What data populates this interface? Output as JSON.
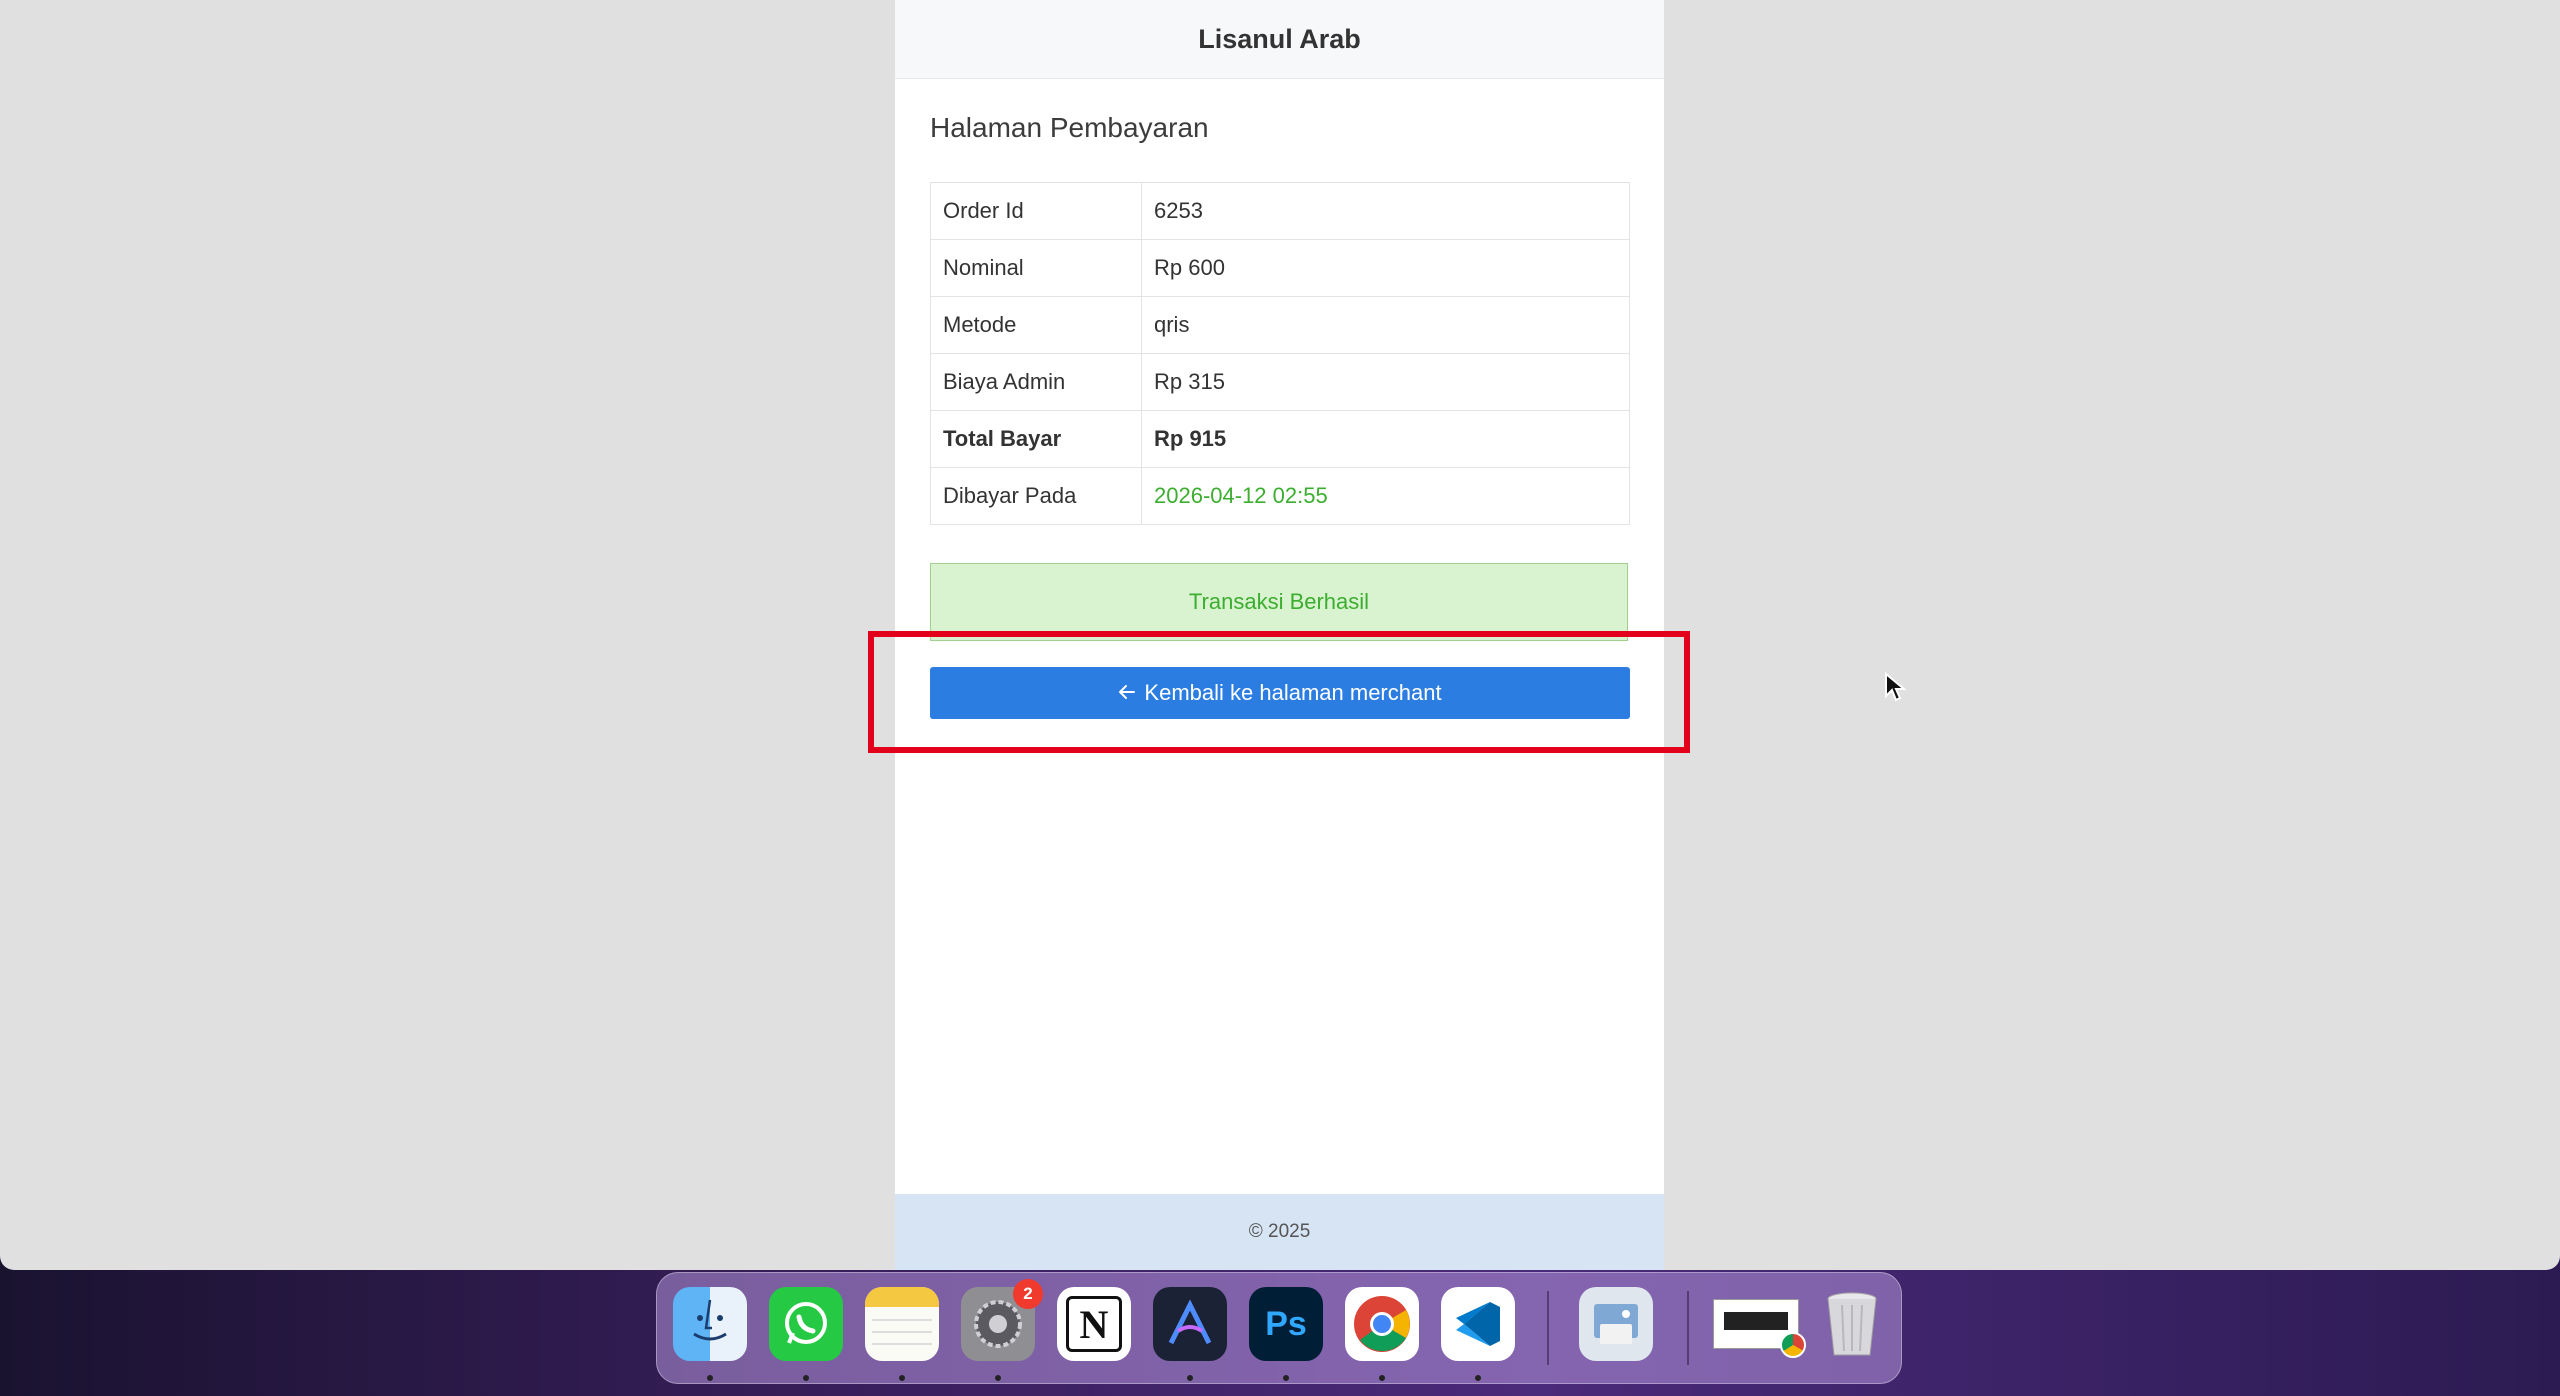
{
  "page": {
    "site_title": "Lisanul Arab",
    "heading": "Halaman Pembayaran",
    "rows": [
      {
        "label": "Order Id",
        "value": "6253"
      },
      {
        "label": "Nominal",
        "value": "Rp 600"
      },
      {
        "label": "Metode",
        "value": "qris"
      },
      {
        "label": "Biaya Admin",
        "value": "Rp 315"
      },
      {
        "label": "Total Bayar",
        "value": "Rp 915"
      },
      {
        "label": "Dibayar Pada",
        "value": "2026-04-12 02:55"
      }
    ],
    "status_message": "Transaksi Berhasil",
    "back_button_label": "Kembali ke halaman merchant",
    "back_button_icon": "arrow-left-icon",
    "footer": "© 2025"
  },
  "colors": {
    "primary_button": "#2b7de1",
    "success_text": "#3cae2f",
    "success_bg": "#d9f2d0",
    "highlight": "#e3001b"
  },
  "dock": {
    "apps": [
      {
        "name": "Finder",
        "icon": "finder-icon",
        "running": true
      },
      {
        "name": "WhatsApp",
        "icon": "whatsapp-icon",
        "running": true
      },
      {
        "name": "Notes",
        "icon": "notes-icon",
        "running": true
      },
      {
        "name": "System Settings",
        "icon": "settings-icon",
        "running": true,
        "badge": "2"
      },
      {
        "name": "Notion",
        "icon": "notion-icon",
        "running": false
      },
      {
        "name": "Affinity Designer",
        "icon": "affinity-icon",
        "running": true
      },
      {
        "name": "Photoshop",
        "icon": "photoshop-icon",
        "running": true
      },
      {
        "name": "Chrome",
        "icon": "chrome-icon",
        "running": true
      },
      {
        "name": "VS Code",
        "icon": "vscode-icon",
        "running": true
      },
      {
        "name": "Preview",
        "icon": "preview-icon",
        "running": false
      },
      {
        "name": "Chrome Window",
        "icon": "window-thumbnail-icon",
        "running": false
      },
      {
        "name": "Trash",
        "icon": "trash-icon",
        "running": false
      }
    ]
  }
}
